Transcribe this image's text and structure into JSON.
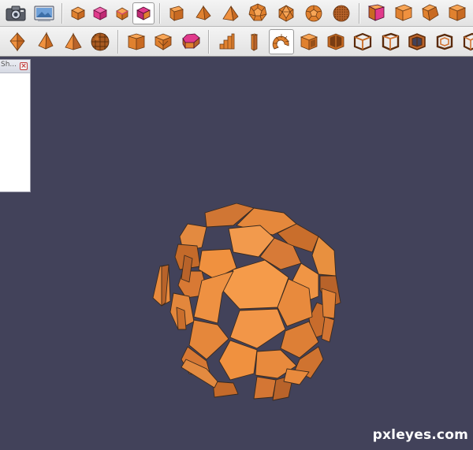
{
  "toolbar_row1": {
    "buttons": [
      {
        "name": "camera-icon"
      },
      {
        "name": "screenshot-icon"
      },
      {
        "name": "cube-icon"
      },
      {
        "name": "cube-pink-icon"
      },
      {
        "name": "cube-small-icon"
      },
      {
        "name": "cube-selected-icon"
      },
      {
        "name": "cube-large-icon"
      },
      {
        "name": "tetrahedron-icon"
      },
      {
        "name": "pyramid-icon"
      },
      {
        "name": "dodecahedron-icon"
      },
      {
        "name": "icosahedron-icon"
      },
      {
        "name": "truncated-icosahedron-icon"
      },
      {
        "name": "geodesic-sphere-icon"
      },
      {
        "name": "cube-pink-face-icon"
      },
      {
        "name": "cube-plain-icon"
      },
      {
        "name": "cube-cut-icon"
      },
      {
        "name": "cube-orange-icon"
      }
    ]
  },
  "toolbar_row2": {
    "buttons": [
      {
        "name": "octahedron-icon"
      },
      {
        "name": "bipyramid-icon"
      },
      {
        "name": "triangular-pyramid-icon"
      },
      {
        "name": "mesh-sphere-icon"
      },
      {
        "name": "prism-icon"
      },
      {
        "name": "truncated-cube-icon"
      },
      {
        "name": "pink-top-prism-icon"
      },
      {
        "name": "stairs-icon"
      },
      {
        "name": "tall-box-icon"
      },
      {
        "name": "spiral-stairs-icon"
      },
      {
        "name": "hollow-cube-icon"
      },
      {
        "name": "open-box-icon"
      },
      {
        "name": "wireframe-cube-icon"
      },
      {
        "name": "frame-cube-icon"
      },
      {
        "name": "cube-frame-solid-icon"
      },
      {
        "name": "small-frame-icon"
      },
      {
        "name": "corner-frame-icon"
      }
    ]
  },
  "side_panel": {
    "title": "Sh...",
    "close_glyph": "×"
  },
  "watermark": "pxleyes.com",
  "colors": {
    "viewport_bg": "#42425a",
    "shape_fill": "#f0913f",
    "shape_light": "#f7a556",
    "shape_dark": "#b8632a",
    "icon_pink": "#e13a8c"
  }
}
